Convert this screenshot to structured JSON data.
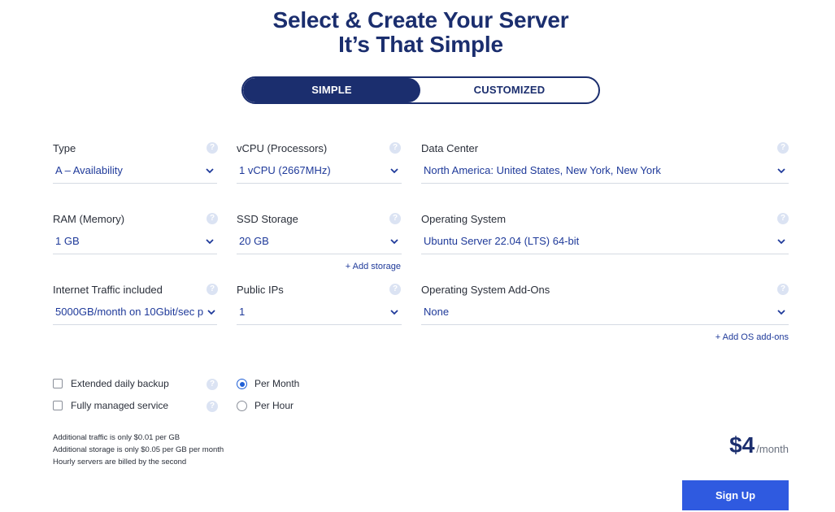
{
  "header": {
    "title_line1": "Select & Create Your Server",
    "title_line2": "It’s That Simple"
  },
  "mode_toggle": {
    "simple": "SIMPLE",
    "customized": "CUSTOMIZED",
    "selected": "SIMPLE"
  },
  "fields": {
    "type": {
      "label": "Type",
      "value": "A – Availability"
    },
    "vcpu": {
      "label": "vCPU (Processors)",
      "value": "1 vCPU (2667MHz)"
    },
    "data_center": {
      "label": "Data Center",
      "value": "North America: United States, New York, New York"
    },
    "ram": {
      "label": "RAM (Memory)",
      "value": "1 GB"
    },
    "ssd": {
      "label": "SSD Storage",
      "value": "20 GB"
    },
    "os": {
      "label": "Operating System",
      "value": "Ubuntu Server 22.04 (LTS) 64-bit"
    },
    "traffic": {
      "label": "Internet Traffic included",
      "value": "5000GB/month on 10Gbit/sec p"
    },
    "public_ips": {
      "label": "Public IPs",
      "value": "1"
    },
    "os_addons": {
      "label": "Operating System Add-Ons",
      "value": "None"
    }
  },
  "links": {
    "add_storage": "+ Add storage",
    "add_os_addons": "+ Add OS add-ons"
  },
  "options": {
    "backup": {
      "label": "Extended daily backup",
      "checked": false
    },
    "managed": {
      "label": "Fully managed service",
      "checked": false
    }
  },
  "billing": {
    "per_month": "Per Month",
    "per_hour": "Per Hour",
    "selected": "Per Month"
  },
  "notes": [
    "Additional traffic is only $0.01 per GB",
    "Additional storage is only $0.05 per GB per month",
    "Hourly servers are billed by the second"
  ],
  "price": {
    "amount": "$4",
    "period": "/month"
  },
  "signup_label": "Sign Up",
  "help_glyph": "?",
  "colors": {
    "navy": "#1b2e6e",
    "link": "#1f3a9a",
    "button": "#2f5ae0",
    "help": "#dbe3f3"
  }
}
